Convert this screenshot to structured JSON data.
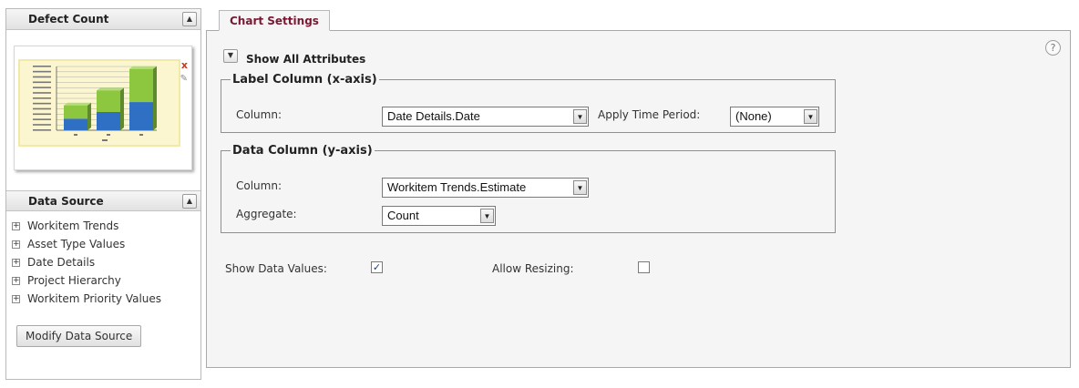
{
  "left": {
    "defect_panel": {
      "title": "Defect Count",
      "collapse_icon": "collapse-up-icon"
    },
    "thumbnail": {
      "close_symbol": "x",
      "edit_symbol": "✎",
      "bars": [
        {
          "lower": 0.14,
          "upper": 0.16
        },
        {
          "lower": 0.22,
          "upper": 0.26
        },
        {
          "lower": 0.34,
          "upper": 0.4
        }
      ],
      "colors": {
        "blue": "#2f6fc4",
        "green": "#8dc63f"
      }
    },
    "data_source": {
      "title": "Data Source",
      "items": [
        {
          "label": "Workitem Trends"
        },
        {
          "label": "Asset Type Values"
        },
        {
          "label": "Date Details"
        },
        {
          "label": "Project Hierarchy"
        },
        {
          "label": "Workitem Priority Values"
        }
      ],
      "modify_button": "Modify Data Source"
    }
  },
  "tab": {
    "label": "Chart Settings",
    "color": "#7a1833"
  },
  "settings": {
    "show_all_label": "Show All Attributes",
    "help_symbol": "?",
    "label_column": {
      "legend": "Label Column (x-axis)",
      "column_label": "Column:",
      "column_value": "Date Details.Date",
      "time_period_label": "Apply Time Period:",
      "time_period_value": "(None)"
    },
    "data_column": {
      "legend": "Data Column (y-axis)",
      "column_label": "Column:",
      "column_value": "Workitem Trends.Estimate",
      "aggregate_label": "Aggregate:",
      "aggregate_value": "Count"
    },
    "show_data_values": {
      "label": "Show Data Values:",
      "checked": true,
      "mark": "✓"
    },
    "allow_resizing": {
      "label": "Allow Resizing:",
      "checked": false
    }
  }
}
